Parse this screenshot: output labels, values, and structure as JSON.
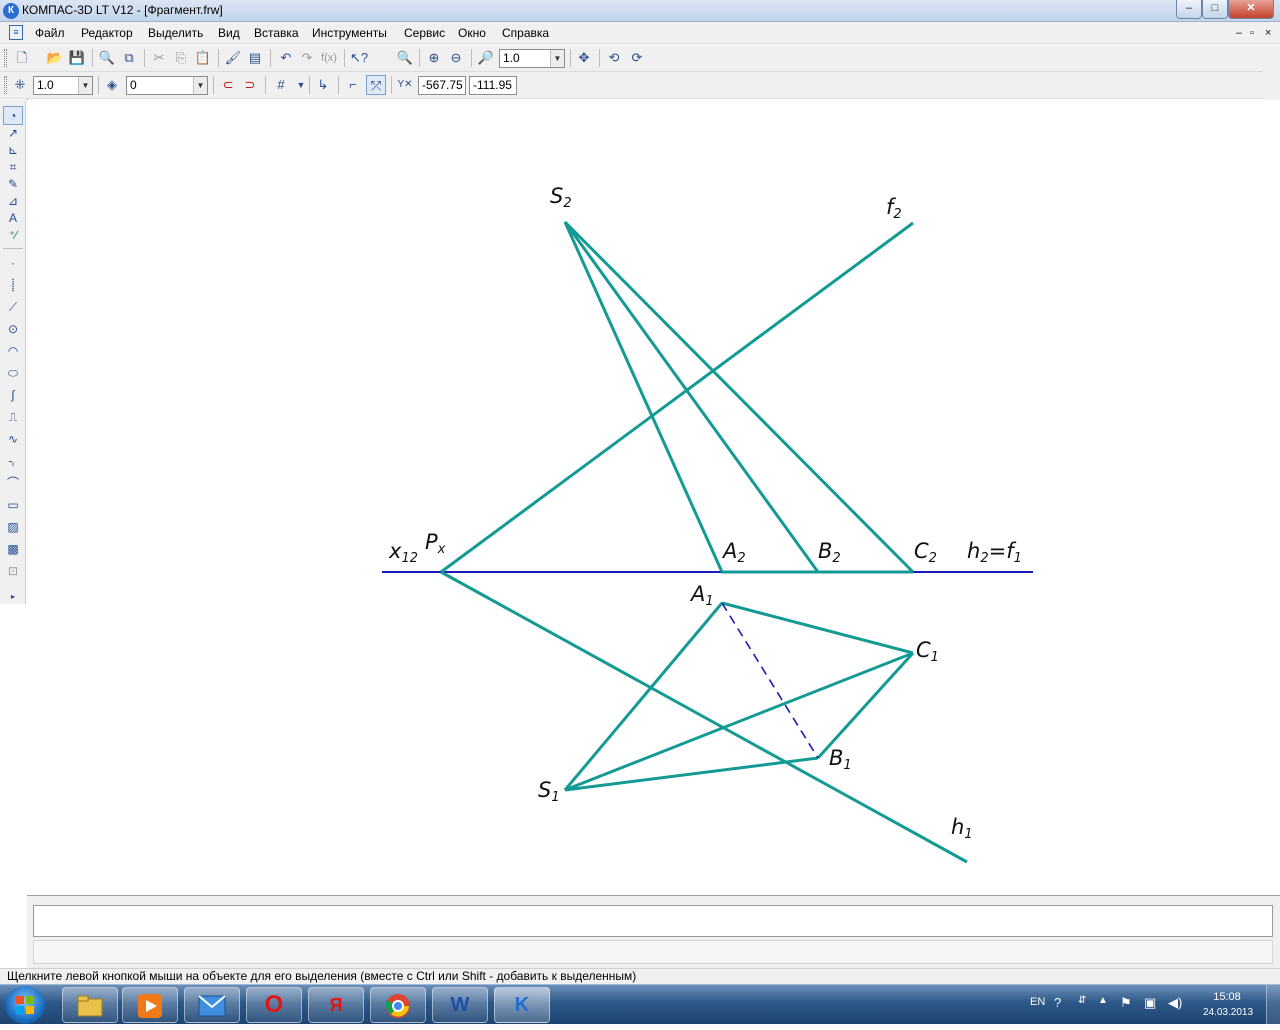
{
  "window": {
    "app_icon": "К",
    "title": "КОМПАС-3D LT V12 - [Фрагмент.frw]",
    "controls": {
      "minimize": "–",
      "maximize": "□",
      "close": "✕"
    }
  },
  "menu": {
    "items": [
      "Файл",
      "Редактор",
      "Выделить",
      "Вид",
      "Вставка",
      "Инструменты",
      "Сервис",
      "Окно",
      "Справка"
    ],
    "right_controls": [
      "–",
      "▫",
      "×"
    ]
  },
  "toolbar1": {
    "zoom_value": "1.0"
  },
  "toolbar2": {
    "step_value": "1.0",
    "layer_value": "0",
    "coord_x": "-567.75",
    "coord_y": "-111.95"
  },
  "drawing": {
    "colors": {
      "teal": "#139a94",
      "blue": "#1a1ab8",
      "dashed": "#1a1ab8"
    },
    "labels": {
      "s2_main": "S",
      "s2_sub": "2",
      "f2_main": "f",
      "f2_sub": "2",
      "x12_main": "x",
      "x12_sub": "12",
      "px_main": "P",
      "px_sub": "x",
      "a2_main": "A",
      "a2_sub": "2",
      "b2_main": "B",
      "b2_sub": "2",
      "c2_main": "C",
      "c2_sub": "2",
      "h2_main": "h",
      "h2_sub": "2",
      "h2_eq": "=f",
      "h2_sub2": "1",
      "a1_main": "A",
      "a1_sub": "1",
      "c1_main": "C",
      "c1_sub": "1",
      "b1_main": "B",
      "b1_sub": "1",
      "s1_main": "S",
      "s1_sub": "1",
      "h1_main": "h",
      "h1_sub": "1"
    }
  },
  "status": {
    "text": "Щелкните левой кнопкой мыши на объекте для его выделения (вместе с Ctrl или Shift - добавить к выделенным)"
  },
  "taskbar": {
    "apps": [
      "explorer-icon",
      "media-player-icon",
      "mail-icon",
      "opera-icon",
      "yandex-icon",
      "chrome-icon",
      "word-icon",
      "kompas-icon"
    ],
    "yandex_letter": "Я",
    "opera_letter": "O",
    "word_letter": "W",
    "kompas_letter": "K",
    "lang": "EN",
    "time": "15:08",
    "date": "24.03.2013"
  }
}
